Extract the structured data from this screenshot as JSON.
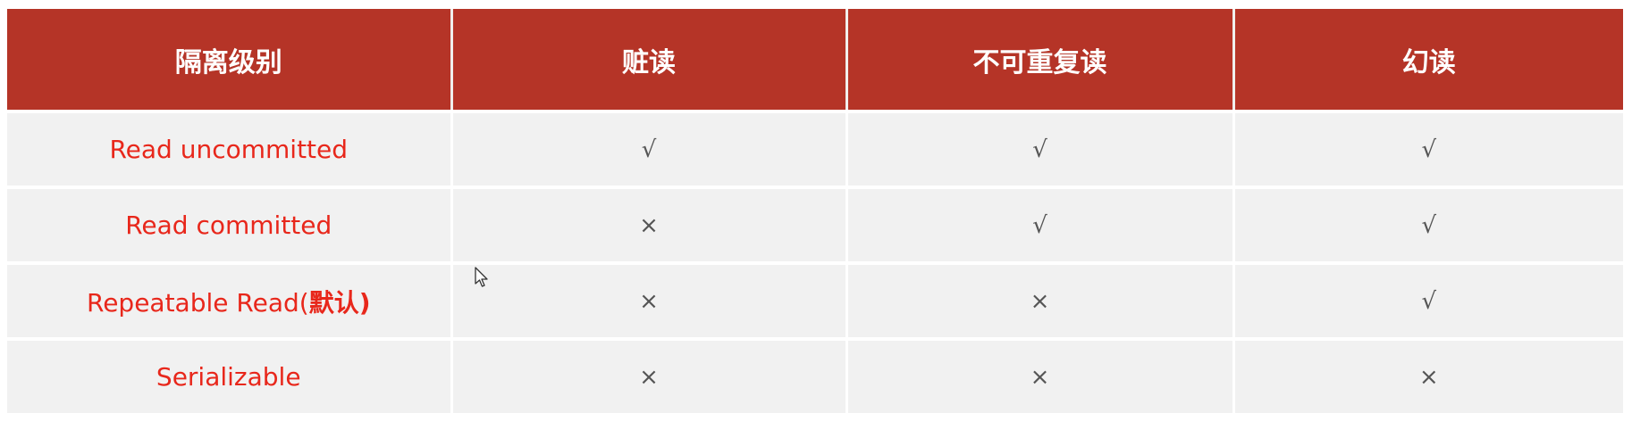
{
  "table": {
    "headers": [
      "隔离级别",
      "赃读",
      "不可重复读",
      "幻读"
    ],
    "rows": [
      {
        "level": "Read uncommitted",
        "note": "",
        "dirty_read": "√",
        "non_repeatable_read": "√",
        "phantom_read": "√"
      },
      {
        "level": "Read committed",
        "note": "",
        "dirty_read": "×",
        "non_repeatable_read": "√",
        "phantom_read": "√"
      },
      {
        "level": "Repeatable Read(",
        "note": "默认)",
        "dirty_read": "×",
        "non_repeatable_read": "×",
        "phantom_read": "√"
      },
      {
        "level": "Serializable",
        "note": "",
        "dirty_read": "×",
        "non_repeatable_read": "×",
        "phantom_read": "×"
      }
    ]
  },
  "colors": {
    "header_bg": "#b53427",
    "header_text": "#ffffff",
    "cell_bg": "#f1f1f1",
    "level_text": "#e8271b",
    "mark_text": "#555555"
  },
  "icons": {
    "cursor": "mouse-pointer-icon"
  }
}
